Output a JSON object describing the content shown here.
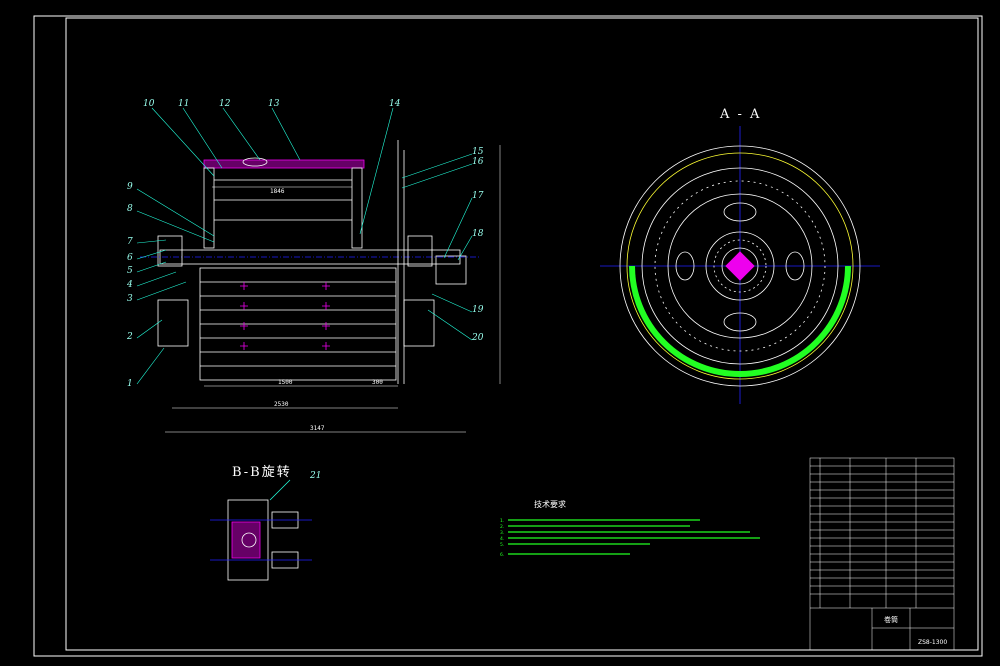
{
  "drawing": {
    "section_aa_title": "A - A",
    "section_bb_title": "B-B旋转",
    "part_labels": [
      "1",
      "2",
      "3",
      "4",
      "5",
      "6",
      "7",
      "8",
      "9",
      "10",
      "11",
      "12",
      "13",
      "14",
      "15",
      "16",
      "17",
      "18",
      "19",
      "20",
      "21"
    ],
    "dims": {
      "d1500": "1500",
      "d300": "300",
      "d2530": "2530",
      "d3147": "3147",
      "d1846": "1846"
    },
    "tech_req_title": "技术要求",
    "tech_req_lines": [
      "1.",
      "2.",
      "3.",
      "4.",
      "5.",
      "6."
    ],
    "title_block": {
      "name": "卷筒",
      "drawing_no": "ZS8-1300"
    }
  },
  "colors": {
    "frame": "#ffffff",
    "outline": "#ffffff",
    "leader": "#2fd",
    "hatch": "#e0e",
    "center": "#22f",
    "green": "#2f2",
    "yellow": "#ff3"
  }
}
